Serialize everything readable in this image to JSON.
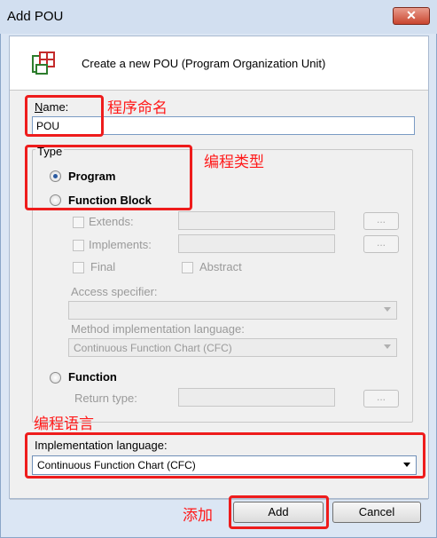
{
  "dialog": {
    "title": "Add POU",
    "close_label": "✕",
    "header_text": "Create a new POU (Program Organization Unit)"
  },
  "name": {
    "label": "Name:",
    "value": "POU"
  },
  "type": {
    "label": "Type",
    "program": "Program",
    "function_block": "Function Block",
    "extends": "Extends:",
    "implements": "Implements:",
    "final": "Final",
    "abstract": "Abstract",
    "access_specifier": "Access specifier:",
    "access_value": "",
    "method_impl_label": "Method implementation language:",
    "method_impl_value": "Continuous Function Chart (CFC)",
    "function": "Function",
    "return_type": "Return type:",
    "ellipsis": "...",
    "selected": "Program"
  },
  "implementation": {
    "label": "Implementation language:",
    "value": "Continuous Function Chart (CFC)"
  },
  "buttons": {
    "add": "Add",
    "cancel": "Cancel"
  },
  "annotations": {
    "name": "程序命名",
    "type": "编程类型",
    "language": "编程语言",
    "add": "添加",
    "color": "#ee1c1c"
  }
}
